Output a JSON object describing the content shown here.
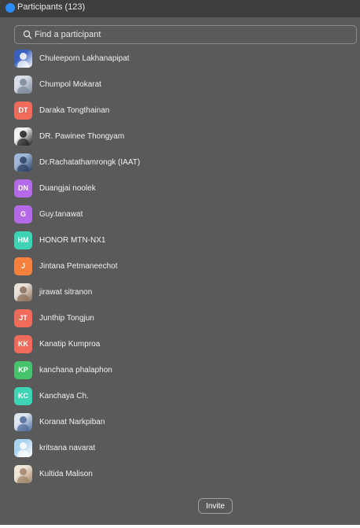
{
  "window": {
    "title": "Participants (123)"
  },
  "search": {
    "placeholder": "Find a participant",
    "value": ""
  },
  "participants": [
    {
      "name": "Chuleeporn Lakhanapipat",
      "avatar": "photo",
      "colors": [
        "#3a5fbf",
        "#ffffff"
      ]
    },
    {
      "name": "Chumpol Mokarat",
      "avatar": "photo",
      "colors": [
        "#d8dde6",
        "#7a8699"
      ]
    },
    {
      "name": "Daraka Tongthainan",
      "avatar": "initials",
      "initials": "DT",
      "color": "#f26a5a"
    },
    {
      "name": "DR. Pawinee Thongyam",
      "avatar": "photo",
      "colors": [
        "#f2f2f2",
        "#1f1f1f"
      ]
    },
    {
      "name": "Dr.Rachatathamrongk (IAAT)",
      "avatar": "photo",
      "colors": [
        "#9fb8d8",
        "#2b3f63"
      ]
    },
    {
      "name": "Duangjai noolek",
      "avatar": "initials",
      "initials": "DN",
      "color": "#b46ae8"
    },
    {
      "name": "Guy.tanawat",
      "avatar": "initials",
      "initials": "G",
      "color": "#b46ae8"
    },
    {
      "name": "HONOR MTN-NX1",
      "avatar": "initials",
      "initials": "HM",
      "color": "#3ed3b5"
    },
    {
      "name": "Jintana Petmaneechot",
      "avatar": "initials",
      "initials": "J",
      "color": "#f5813c"
    },
    {
      "name": "jirawat sitranon",
      "avatar": "photo",
      "colors": [
        "#e8e2da",
        "#8a6d57"
      ]
    },
    {
      "name": "Junthip Tongjun",
      "avatar": "initials",
      "initials": "JT",
      "color": "#f26a5a"
    },
    {
      "name": "Kanatip Kumproa",
      "avatar": "initials",
      "initials": "KK",
      "color": "#f26a5a"
    },
    {
      "name": "kanchana phalaphon",
      "avatar": "initials",
      "initials": "KP",
      "color": "#45c46c"
    },
    {
      "name": "Kanchaya Ch.",
      "avatar": "initials",
      "initials": "KC",
      "color": "#3ed3b5"
    },
    {
      "name": "Koranat Narkpiban",
      "avatar": "photo",
      "colors": [
        "#dfe7f2",
        "#4b6a9a"
      ]
    },
    {
      "name": "kritsana navarat",
      "avatar": "photo",
      "colors": [
        "#a9d3ee",
        "#ffffff"
      ]
    },
    {
      "name": "Kultida Malison",
      "avatar": "photo",
      "colors": [
        "#efe6d8",
        "#a08366"
      ]
    }
  ],
  "footer": {
    "invite_label": "Invite"
  }
}
